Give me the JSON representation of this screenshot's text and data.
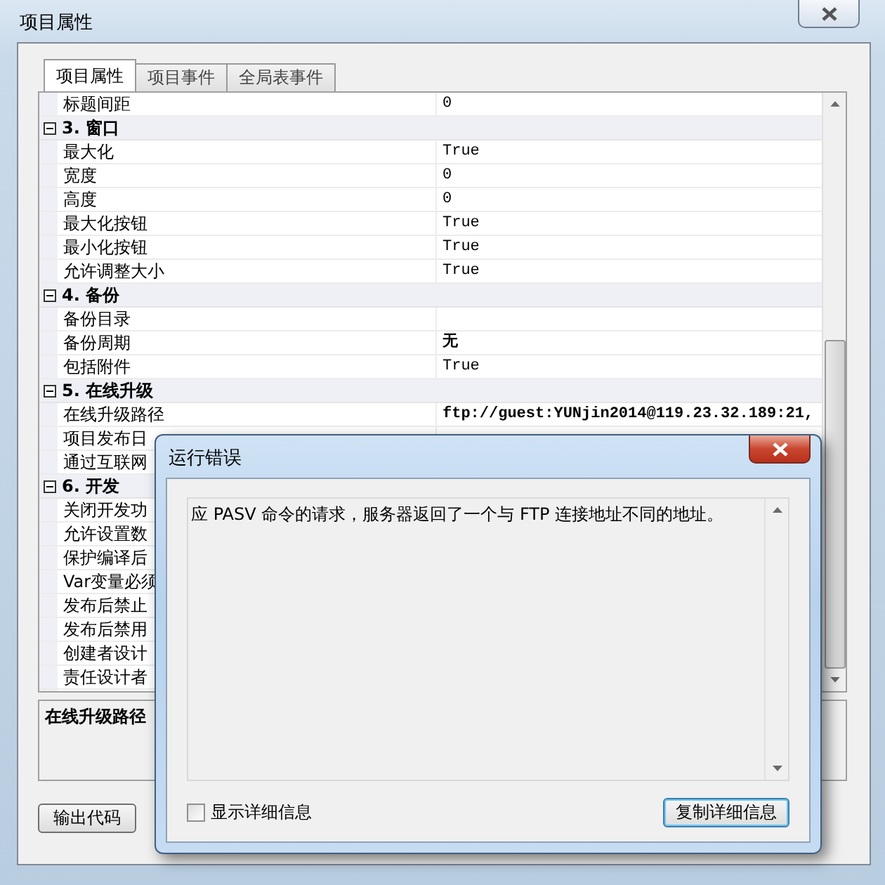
{
  "window": {
    "title": "项目属性"
  },
  "tabs": [
    {
      "label": "项目属性",
      "selected": true
    },
    {
      "label": "项目事件",
      "selected": false
    },
    {
      "label": "全局表事件",
      "selected": false
    }
  ],
  "grid": {
    "rows": [
      {
        "kind": "property",
        "name": "标题间距",
        "value": "0"
      },
      {
        "kind": "category",
        "label": "3. 窗口",
        "expanded": true,
        "children": [
          {
            "kind": "property",
            "name": "最大化",
            "value": "True"
          },
          {
            "kind": "property",
            "name": "宽度",
            "value": "0"
          },
          {
            "kind": "property",
            "name": "高度",
            "value": "0"
          },
          {
            "kind": "property",
            "name": "最大化按钮",
            "value": "True"
          },
          {
            "kind": "property",
            "name": "最小化按钮",
            "value": "True"
          },
          {
            "kind": "property",
            "name": "允许调整大小",
            "value": "True"
          }
        ]
      },
      {
        "kind": "category",
        "label": "4. 备份",
        "expanded": true,
        "children": [
          {
            "kind": "property",
            "name": "备份目录"
          },
          {
            "kind": "property",
            "name": "备份周期",
            "value": "无",
            "bold": true
          },
          {
            "kind": "property",
            "name": "包括附件",
            "value": "True"
          }
        ]
      },
      {
        "kind": "category",
        "label": "5. 在线升级",
        "expanded": true,
        "children": [
          {
            "kind": "property",
            "name": "在线升级路径",
            "value": "ftp://guest:YUNjin2014@119.23.32.189:21,",
            "bold": true
          },
          {
            "kind": "property",
            "name": "项目发布日"
          },
          {
            "kind": "property",
            "name": "通过互联网"
          }
        ]
      },
      {
        "kind": "category",
        "label": "6. 开发",
        "expanded": true,
        "children": [
          {
            "kind": "property",
            "name": "关闭开发功"
          },
          {
            "kind": "property",
            "name": "允许设置数"
          },
          {
            "kind": "property",
            "name": "保护编译后"
          },
          {
            "kind": "property",
            "name": "Var变量必须"
          },
          {
            "kind": "property",
            "name": "发布后禁止"
          },
          {
            "kind": "property",
            "name": "发布后禁用"
          },
          {
            "kind": "property",
            "name": "创建者设计"
          },
          {
            "kind": "property",
            "name": "责任设计者"
          }
        ]
      }
    ]
  },
  "description": {
    "title": "在线升级路径"
  },
  "buttons": [
    "输出代码"
  ],
  "dialog": {
    "title": "运行错误",
    "message": "应 PASV 命令的请求，服务器返回了一个与 FTP 连接地址不同的地址。",
    "details_checkbox": {
      "label": "显示详细信息",
      "checked": false
    },
    "button": "复制详细信息"
  }
}
